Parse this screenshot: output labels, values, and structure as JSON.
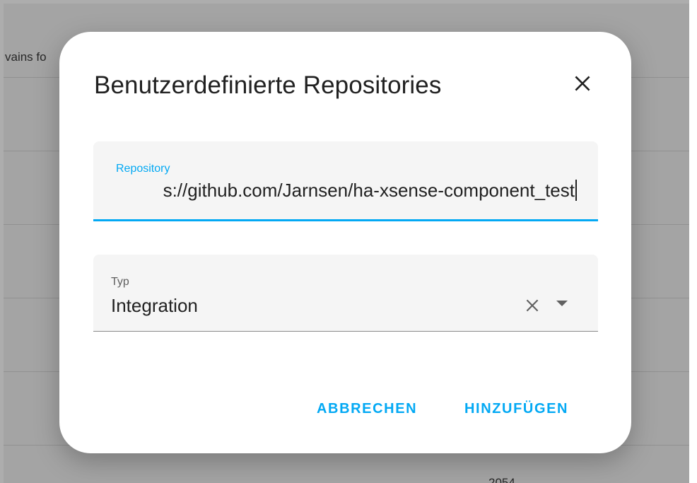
{
  "background": {
    "partial_text": "vains fo",
    "partial_number": "2054"
  },
  "dialog": {
    "title": "Benutzerdefinierte Repositories",
    "close_icon": "close-icon",
    "repository_field": {
      "label": "Repository",
      "value": "s://github.com/Jarnsen/ha-xsense-component_test"
    },
    "type_field": {
      "label": "Typ",
      "value": "Integration",
      "clear_icon": "clear-icon",
      "dropdown_icon": "dropdown-arrow-icon"
    },
    "actions": {
      "cancel_label": "ABBRECHEN",
      "add_label": "HINZUFÜGEN"
    }
  },
  "colors": {
    "accent": "#03a9f4",
    "text_primary": "#212121",
    "field_background": "#f5f5f5"
  }
}
